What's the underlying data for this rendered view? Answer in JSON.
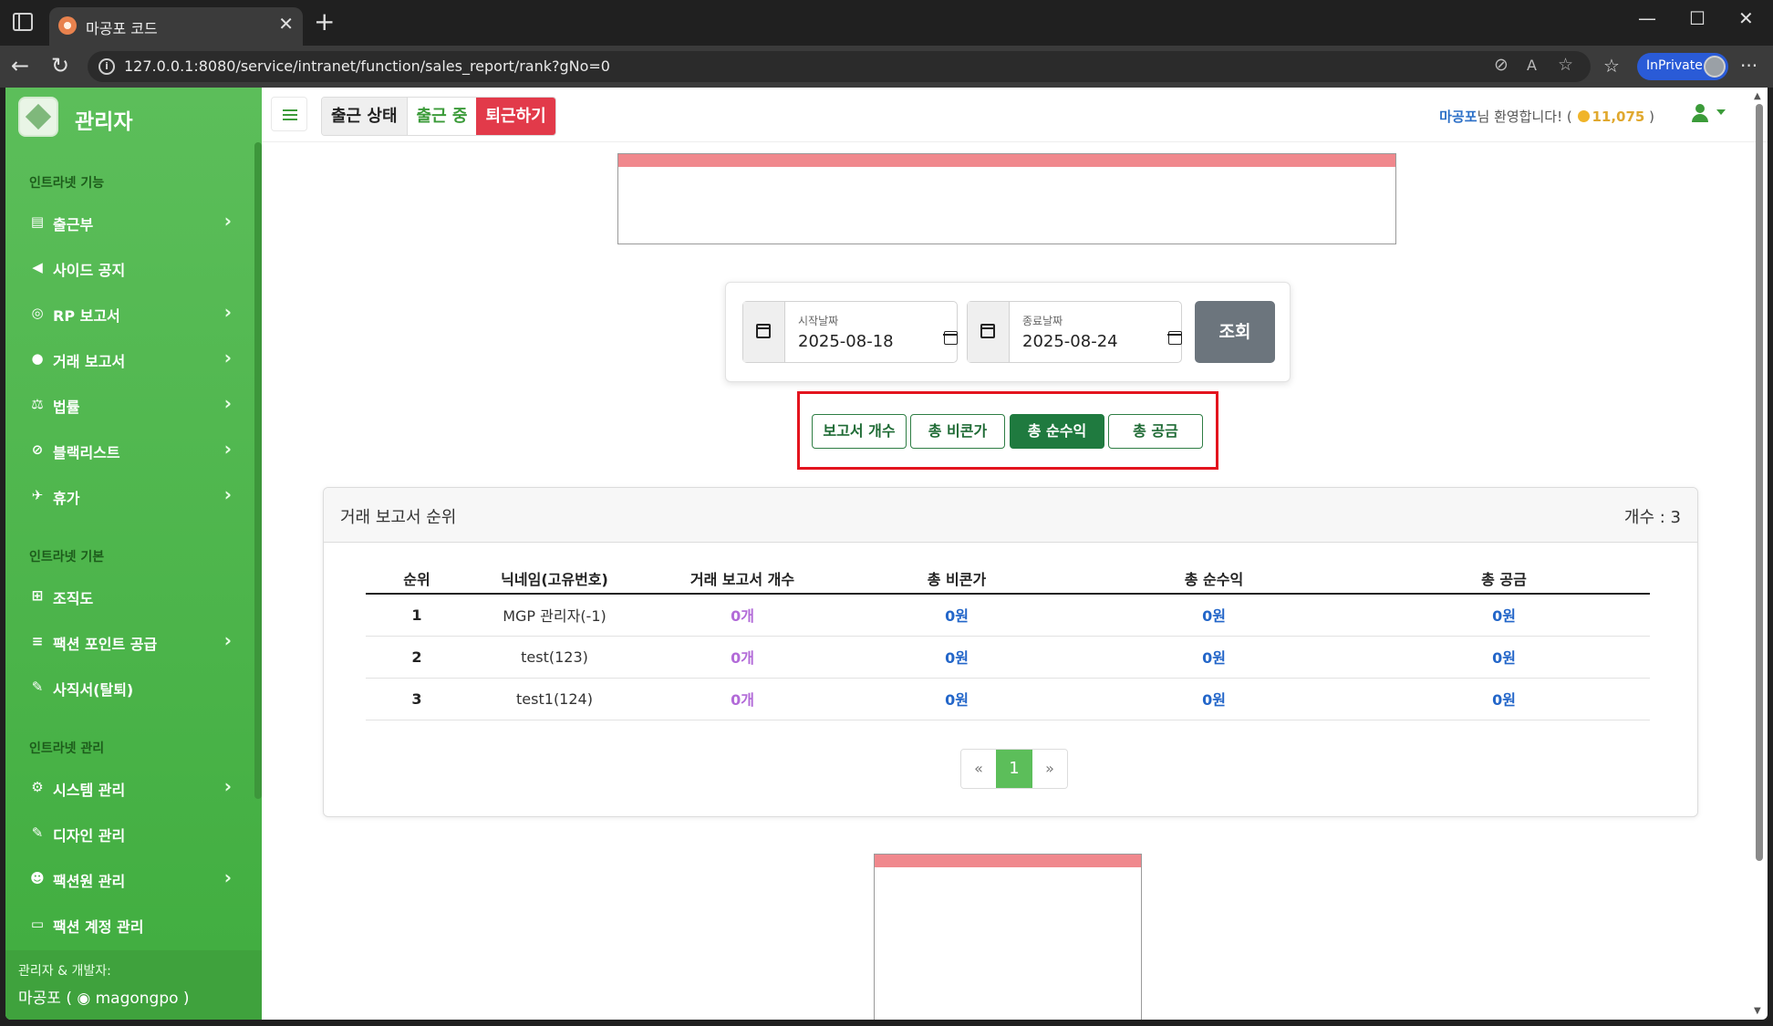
{
  "browser": {
    "tab_title": "마공포 코드",
    "tab_close": "✕",
    "new_tab": "+",
    "url": "127.0.0.1:8080/service/intranet/function/sales_report/rank?gNo=0",
    "inprivate_label": "InPrivate",
    "win_min": "—",
    "win_max": "☐",
    "win_close": "✕",
    "more": "···"
  },
  "sidebar": {
    "brand": "관리자",
    "sections": [
      {
        "heading": "인트라넷 기능",
        "items": [
          {
            "label": "출근부",
            "icon": "book-icon",
            "chevron": true
          },
          {
            "label": "사이드 공지",
            "icon": "megaphone-icon",
            "chevron": false
          },
          {
            "label": "RP 보고서",
            "icon": "gamepad-icon",
            "chevron": true
          },
          {
            "label": "거래 보고서",
            "icon": "money-bag-icon",
            "chevron": true
          },
          {
            "label": "법률",
            "icon": "scale-icon",
            "chevron": true
          },
          {
            "label": "블랙리스트",
            "icon": "ban-icon",
            "chevron": true
          },
          {
            "label": "휴가",
            "icon": "plane-icon",
            "chevron": true
          }
        ]
      },
      {
        "heading": "인트라넷 기본",
        "items": [
          {
            "label": "조직도",
            "icon": "sitemap-icon",
            "chevron": false
          },
          {
            "label": "팩션 포인트 공급",
            "icon": "coins-icon",
            "chevron": true
          },
          {
            "label": "사직서(탈퇴)",
            "icon": "pen-icon",
            "chevron": false
          }
        ]
      },
      {
        "heading": "인트라넷 관리",
        "items": [
          {
            "label": "시스템 관리",
            "icon": "gear-icon",
            "chevron": true
          },
          {
            "label": "디자인 관리",
            "icon": "brush-icon",
            "chevron": false
          },
          {
            "label": "팩션원 관리",
            "icon": "users-cog-icon",
            "chevron": true
          },
          {
            "label": "팩션 계정 관리",
            "icon": "id-card-icon",
            "chevron": false
          }
        ]
      }
    ],
    "footer_line1": "관리자 & 개발자:",
    "footer_line2": "마공포 ( ◉ magongpo )"
  },
  "topbar": {
    "attendance_label": "출근 상태",
    "attendance_status": "출근 중",
    "leave_button": "퇴근하기",
    "welcome_name": "마공포",
    "welcome_text": "님 환영합니다! (",
    "points": "11,075",
    "welcome_close": " )"
  },
  "filter": {
    "start_label": "시작날짜",
    "start_value": "2025-08-18",
    "end_label": "종료날짜",
    "end_value": "2025-08-24",
    "query_button": "조회"
  },
  "metric_buttons": [
    {
      "label": "보고서 개수",
      "active": false
    },
    {
      "label": "총 비콘가",
      "active": false
    },
    {
      "label": "총 순수익",
      "active": true
    },
    {
      "label": "총 공금",
      "active": false
    }
  ],
  "ranking": {
    "title": "거래 보고서 순위",
    "count_label": "개수 : 3",
    "columns": [
      "순위",
      "닉네임(고유번호)",
      "거래 보고서 개수",
      "총 비콘가",
      "총 순수익",
      "총 공금"
    ],
    "rows": [
      {
        "rank": "1",
        "nick": "MGP 관리자(-1)",
        "count": "0개",
        "beacon": "0원",
        "profit": "0원",
        "fund": "0원"
      },
      {
        "rank": "2",
        "nick": "test(123)",
        "count": "0개",
        "beacon": "0원",
        "profit": "0원",
        "fund": "0원"
      },
      {
        "rank": "3",
        "nick": "test1(124)",
        "count": "0개",
        "beacon": "0원",
        "profit": "0원",
        "fund": "0원"
      }
    ],
    "pager": {
      "prev": "«",
      "current": "1",
      "next": "»"
    }
  },
  "colors": {
    "sidebar_green": "#4fb54d",
    "leave_red": "#e23a4a",
    "active_metric": "#1f7a3f",
    "money_blue": "#2366c9",
    "count_purple": "#b26ad8",
    "highlight_red": "#e3141e"
  }
}
